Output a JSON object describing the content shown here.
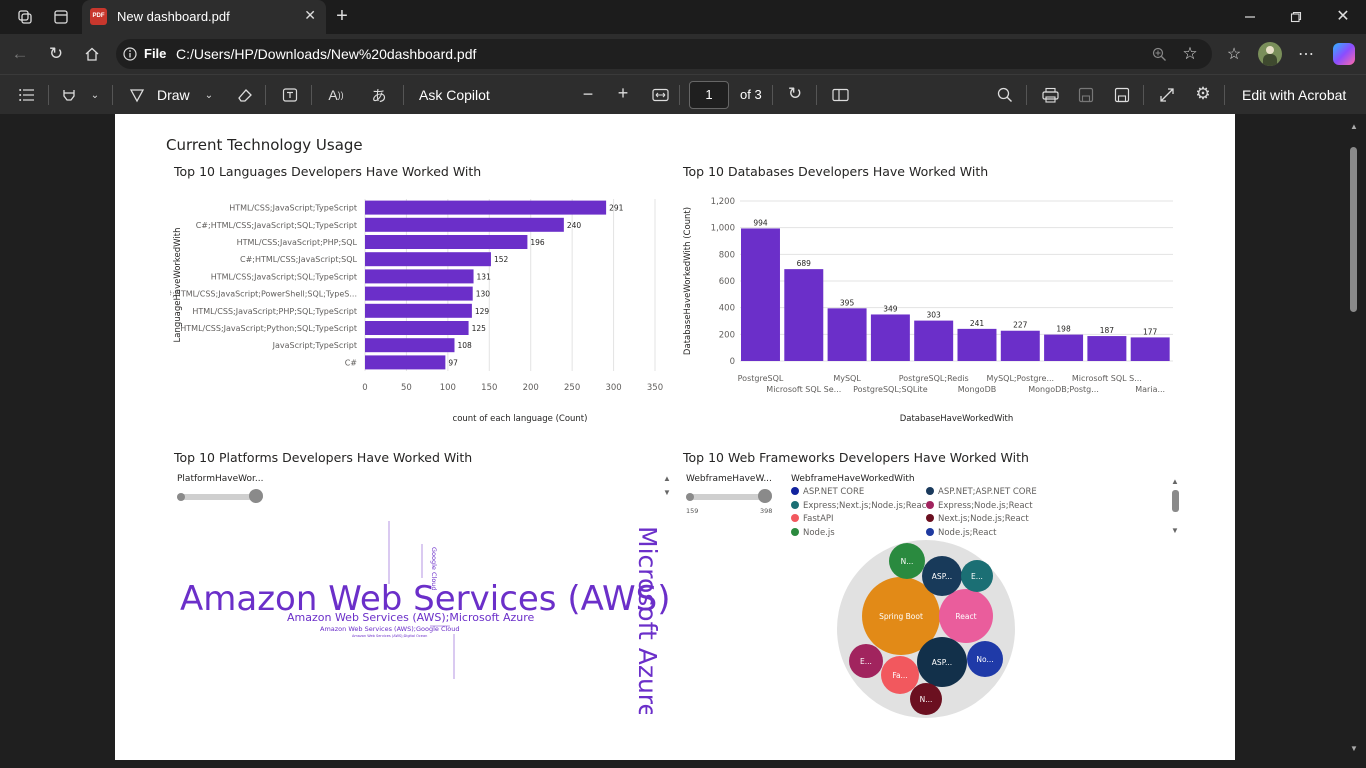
{
  "browser": {
    "tab_title": "New dashboard.pdf",
    "tab_icon_label": "PDF",
    "address_prefix": "File",
    "url": "C:/Users/HP/Downloads/New%20dashboard.pdf"
  },
  "pdf_toolbar": {
    "draw_label": "Draw",
    "ask_copilot_label": "Ask Copilot",
    "page_number": "1",
    "page_total": "of 3",
    "edit_acrobat_label": "Edit with Acrobat"
  },
  "dashboard": {
    "section_title": "Current Technology Usage"
  },
  "charts": {
    "languages": {
      "title": "Top 10 Languages Developers Have Worked With",
      "ylabel": "LanguageHaveWorkedWith",
      "xlabel": "count of each language (Count)",
      "ticks": [
        "0",
        "50",
        "100",
        "150",
        "200",
        "250",
        "300",
        "350"
      ]
    },
    "databases": {
      "title": "Top 10 Databases Developers Have Worked With",
      "ylabel": "DatabaseHaveWorkedWith (Count)",
      "xlabel": "DatabaseHaveWorkedWith",
      "ticks": [
        "0",
        "200",
        "400",
        "600",
        "800",
        "1,000",
        "1,200"
      ]
    },
    "platforms": {
      "title": "Top 10 Platforms Developers Have Worked With",
      "slider_label": "PlatformHaveWor...",
      "words": [
        {
          "text": "Amazon Web Services (AWS)"
        },
        {
          "text": "Microsoft Azure"
        },
        {
          "text": "Amazon Web Services (AWS);Microsoft Azure"
        },
        {
          "text": "Amazon Web Services (AWS);Google Cloud"
        },
        {
          "text": "Google Cloud"
        },
        {
          "text": "Amazon Web Services (AWS);Digital Ocean"
        }
      ]
    },
    "frameworks": {
      "title": "Top 10 Web Frameworks Developers Have Worked With",
      "slider_label": "WebframeHaveW...",
      "slider_min": "159",
      "slider_max": "398",
      "legend_title": "WebframeHaveWorkedWith",
      "legend": [
        {
          "label": "ASP.NET CORE",
          "color": "#12239e"
        },
        {
          "label": "ASP.NET;ASP.NET CORE",
          "color": "#1a3a5c"
        },
        {
          "label": "Express;Next.js;Node.js;React",
          "color": "#1b6f74"
        },
        {
          "label": "Express;Node.js;React",
          "color": "#a1245e"
        },
        {
          "label": "FastAPI",
          "color": "#f2585e"
        },
        {
          "label": "Next.js;Node.js;React",
          "color": "#6b1020"
        },
        {
          "label": "Node.js",
          "color": "#2b8a3e"
        },
        {
          "label": "Node.js;React",
          "color": "#1f3aa0"
        }
      ],
      "bubbles": [
        {
          "label": "Spring Boot",
          "color": "#e28a17"
        },
        {
          "label": "React",
          "color": "#ea5d9c"
        },
        {
          "label": "ASP...",
          "color": "#183a5a"
        },
        {
          "label": "ASP...",
          "color": "#12304a"
        },
        {
          "label": "N...",
          "color": "#2a8a3f"
        },
        {
          "label": "E...",
          "color": "#1b6f74"
        },
        {
          "label": "No...",
          "color": "#1f3aa8"
        },
        {
          "label": "Fa...",
          "color": "#f2585e"
        },
        {
          "label": "E...",
          "color": "#a1245e"
        },
        {
          "label": "N...",
          "color": "#6b1020"
        }
      ]
    }
  },
  "chart_data": [
    {
      "type": "bar",
      "orientation": "horizontal",
      "title": "Top 10 Languages Developers Have Worked With",
      "xlabel": "count of each language (Count)",
      "ylabel": "LanguageHaveWorkedWith",
      "xlim": [
        0,
        350
      ],
      "categories": [
        "HTML/CSS;JavaScript;TypeScript",
        "C#;HTML/CSS;JavaScript;SQL;TypeScript",
        "HTML/CSS;JavaScript;PHP;SQL",
        "C#;HTML/CSS;JavaScript;SQL",
        "HTML/CSS;JavaScript;SQL;TypeScript",
        "C#;HTML/CSS;JavaScript;PowerShell;SQL;TypeS...",
        "HTML/CSS;JavaScript;PHP;SQL;TypeScript",
        "HTML/CSS;JavaScript;Python;SQL;TypeScript",
        "JavaScript;TypeScript",
        "C#"
      ],
      "values": [
        291,
        240,
        196,
        152,
        131,
        130,
        129,
        125,
        108,
        97
      ],
      "color": "#6b2fc9",
      "grid": true
    },
    {
      "type": "bar",
      "title": "Top 10 Databases Developers Have Worked With",
      "xlabel": "DatabaseHaveWorkedWith",
      "ylabel": "DatabaseHaveWorkedWith (Count)",
      "ylim": [
        0,
        1200
      ],
      "categories": [
        "PostgreSQL",
        "Microsoft SQL Se...",
        "MySQL",
        "PostgreSQL;SQLite",
        "PostgreSQL;Redis",
        "MongoDB",
        "MySQL;Postgre...",
        "MongoDB;Postg...",
        "Microsoft SQL S...",
        "Maria..."
      ],
      "values": [
        994,
        689,
        395,
        349,
        303,
        241,
        227,
        198,
        187,
        177
      ],
      "color": "#6b2fc9",
      "grid": true
    }
  ]
}
